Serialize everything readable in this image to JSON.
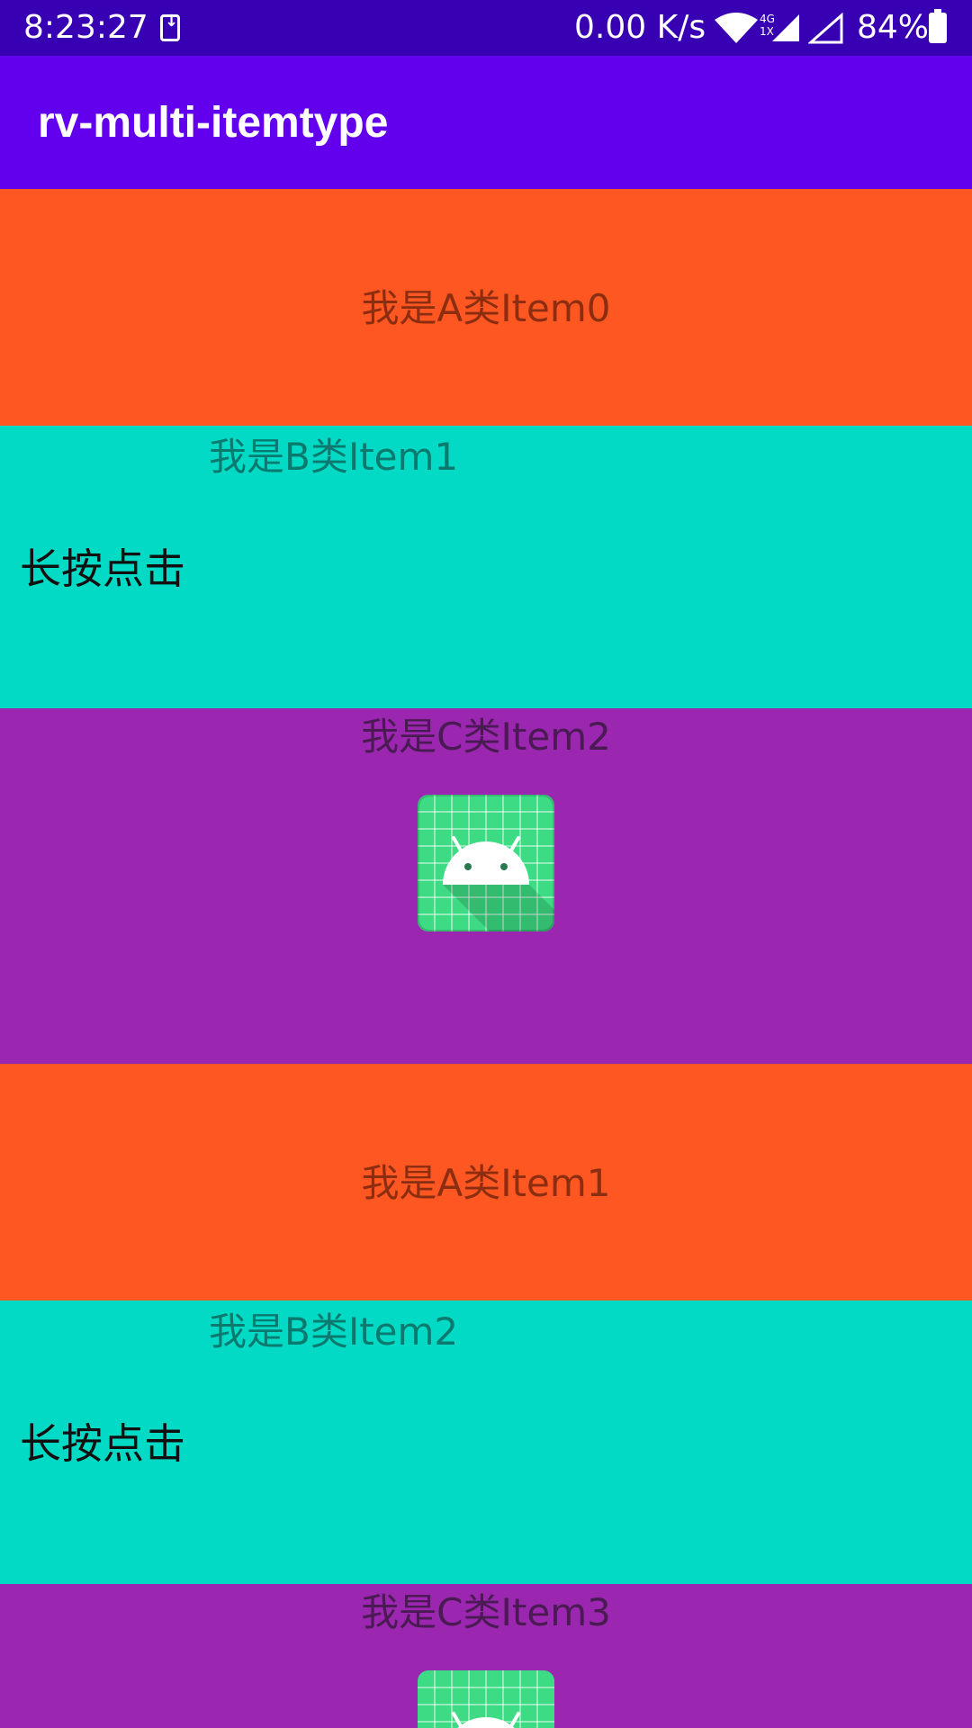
{
  "status_bar": {
    "time": "8:23:27",
    "net_speed": "0.00 K/s",
    "network_type_top": "4G",
    "network_type_bottom": "1X",
    "battery": "84%",
    "icons": [
      "download-icon",
      "wifi-icon",
      "signal-icon",
      "signal-empty-icon",
      "battery-icon"
    ]
  },
  "app_bar": {
    "title": "rv-multi-itemtype"
  },
  "colors": {
    "status_bar": "#3700b3",
    "app_bar": "#6200ee",
    "item_a": "#ff5722",
    "item_b": "#03dac5",
    "item_c": "#9b27b0"
  },
  "list": {
    "items": [
      {
        "type": "A",
        "text": "我是A类Item0"
      },
      {
        "type": "B",
        "text": "我是B类Item1",
        "action_text": "长按点击"
      },
      {
        "type": "C",
        "text": "我是C类Item2",
        "icon": "android-icon"
      },
      {
        "type": "A",
        "text": "我是A类Item1"
      },
      {
        "type": "B",
        "text": "我是B类Item2",
        "action_text": "长按点击"
      },
      {
        "type": "C",
        "text": "我是C类Item3",
        "icon": "android-icon"
      }
    ]
  }
}
